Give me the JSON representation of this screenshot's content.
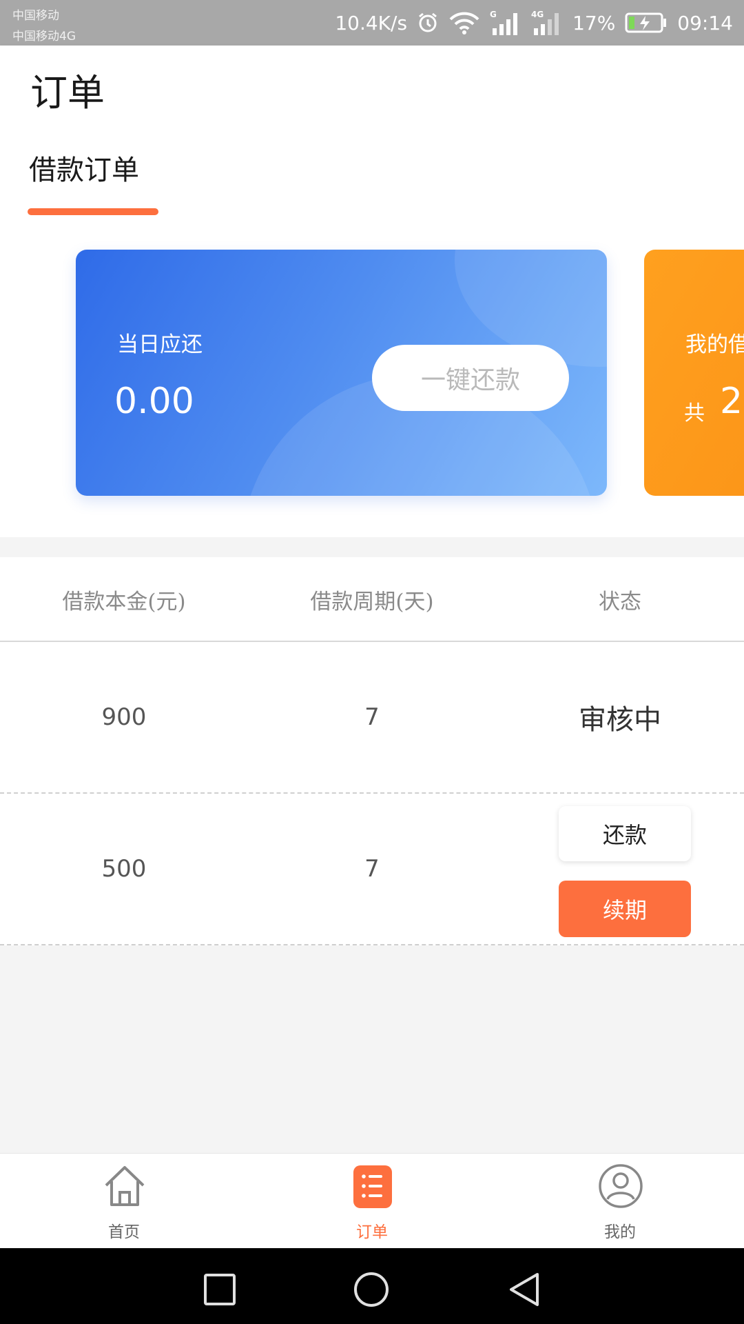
{
  "status_bar": {
    "carrier_1": "中国移动",
    "carrier_2": "中国移动4G",
    "net_speed": "10.4K/s",
    "signal_1_tag": "G",
    "signal_2_tag": "4G",
    "battery_percent": "17%",
    "time": "09:14"
  },
  "header": {
    "title": "订单",
    "tab_loans": "借款订单"
  },
  "cards": {
    "due_today": {
      "label": "当日应还",
      "amount": "0.00",
      "button": "一键还款"
    },
    "my_loans": {
      "label": "我的借",
      "total_prefix": "共",
      "count": "2"
    }
  },
  "table": {
    "headers": [
      "借款本金(元)",
      "借款周期(天)",
      "状态"
    ],
    "rows": [
      {
        "principal": "900",
        "period": "7",
        "status": "审核中"
      },
      {
        "principal": "500",
        "period": "7",
        "repay_label": "还款",
        "renew_label": "续期"
      }
    ]
  },
  "bottom_nav": {
    "items": [
      {
        "label": "首页",
        "icon": "home-icon"
      },
      {
        "label": "订单",
        "icon": "orders-icon"
      },
      {
        "label": "我的",
        "icon": "user-icon"
      }
    ],
    "active_index": 1
  },
  "colors": {
    "accent": "#fd6f3e",
    "card_blue_start": "#2f6be8",
    "card_blue_end": "#7db8fb",
    "card_orange": "#ffa01f"
  }
}
